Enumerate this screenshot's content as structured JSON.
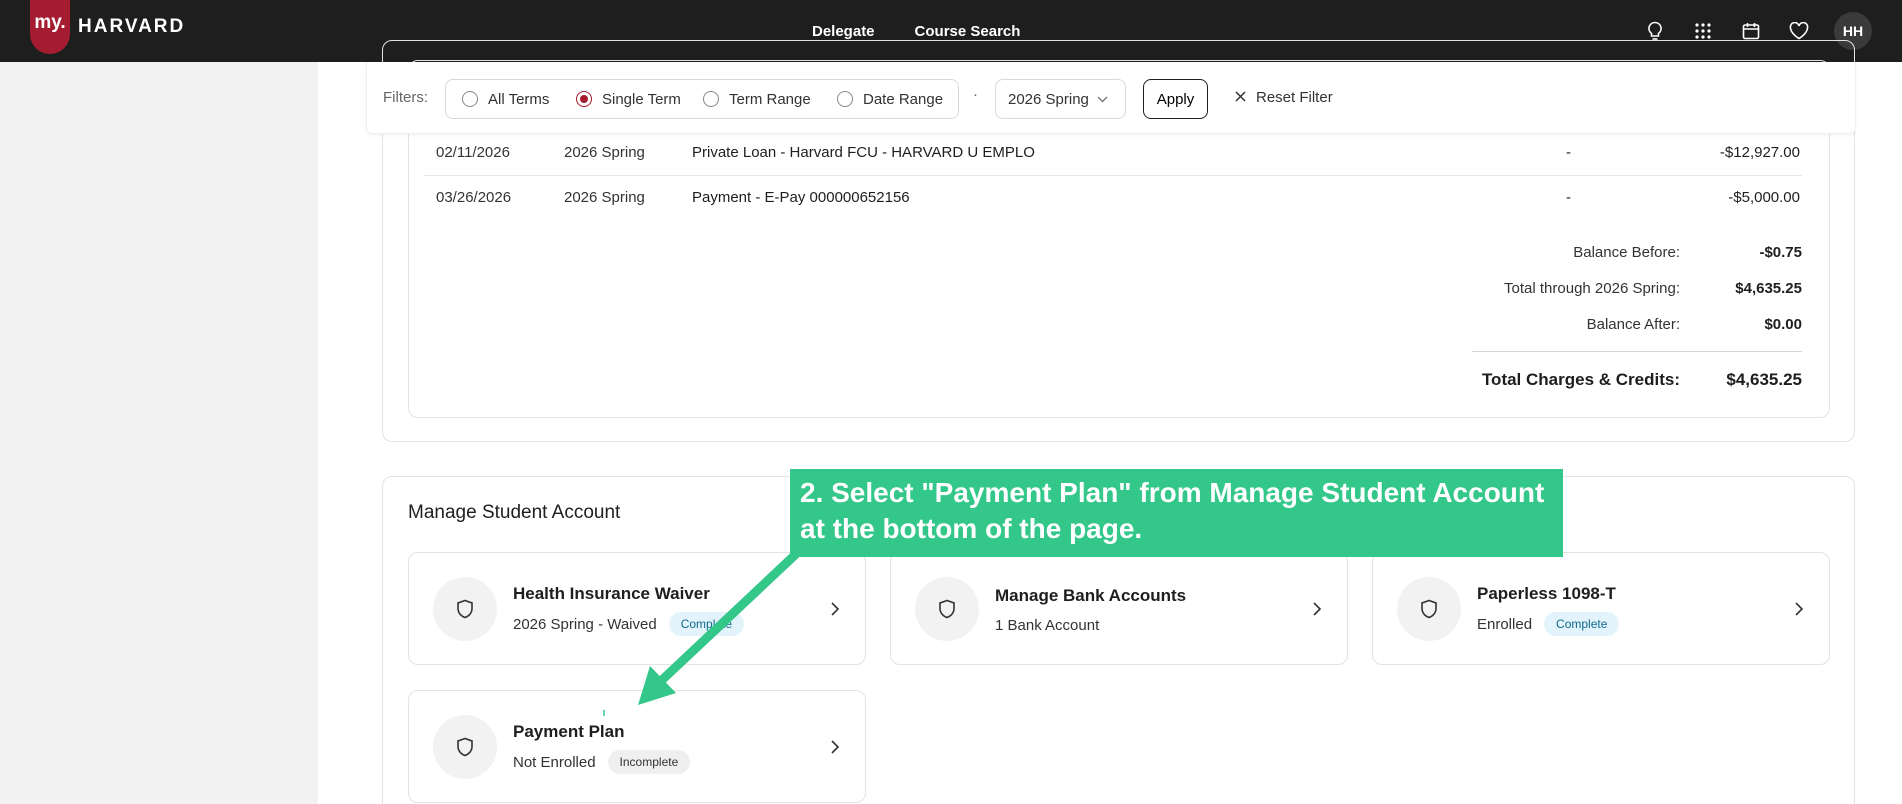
{
  "topbar": {
    "logo_my": "my.",
    "logo_text": "HARVARD",
    "nav": [
      "Delegate",
      "Course Search"
    ],
    "icons": [
      "lightbulb-icon",
      "apps-grid-icon",
      "calendar-icon",
      "heart-icon"
    ],
    "avatar_initials": "HH"
  },
  "filters": {
    "label": "Filters:",
    "options": [
      "All Terms",
      "Single Term",
      "Term Range",
      "Date Range"
    ],
    "selected": "Single Term",
    "separator": "·",
    "term_value": "2026 Spring",
    "apply_label": "Apply",
    "reset_label": "Reset Filter"
  },
  "charges": {
    "rows": [
      {
        "date": "02/11/2026",
        "term": "2026 Spring",
        "description": "Private Loan - Harvard FCU - HARVARD U EMPLO",
        "debit": "-",
        "amount": "-$12,927.00"
      },
      {
        "date": "03/26/2026",
        "term": "2026 Spring",
        "description": "Payment - E-Pay 000000652156",
        "debit": "-",
        "amount": "-$5,000.00"
      }
    ],
    "summary": {
      "balance_before_label": "Balance Before:",
      "balance_before_value": "-$0.75",
      "total_through_label": "Total through 2026 Spring:",
      "total_through_value": "$4,635.25",
      "balance_after_label": "Balance After:",
      "balance_after_value": "$0.00",
      "total_label": "Total Charges & Credits:",
      "total_value": "$4,635.25"
    }
  },
  "manage": {
    "title": "Manage Student Account",
    "cards": [
      {
        "title": "Health Insurance Waiver",
        "subtitle": "2026 Spring - Waived",
        "badge": "Complete"
      },
      {
        "title": "Manage Bank Accounts",
        "subtitle": "1 Bank Account",
        "badge": ""
      },
      {
        "title": "Paperless 1098-T",
        "subtitle": "Enrolled",
        "badge": "Complete"
      },
      {
        "title": "Payment Plan",
        "subtitle": "Not Enrolled",
        "badge": "Incomplete"
      }
    ]
  },
  "annotation": {
    "text": "2. Select \"Payment Plan\" from Manage Student Account at the bottom of the page."
  },
  "colors": {
    "brand": "#a51c30",
    "topbar": "#1e1e1e",
    "annotation": "#33c78a"
  }
}
